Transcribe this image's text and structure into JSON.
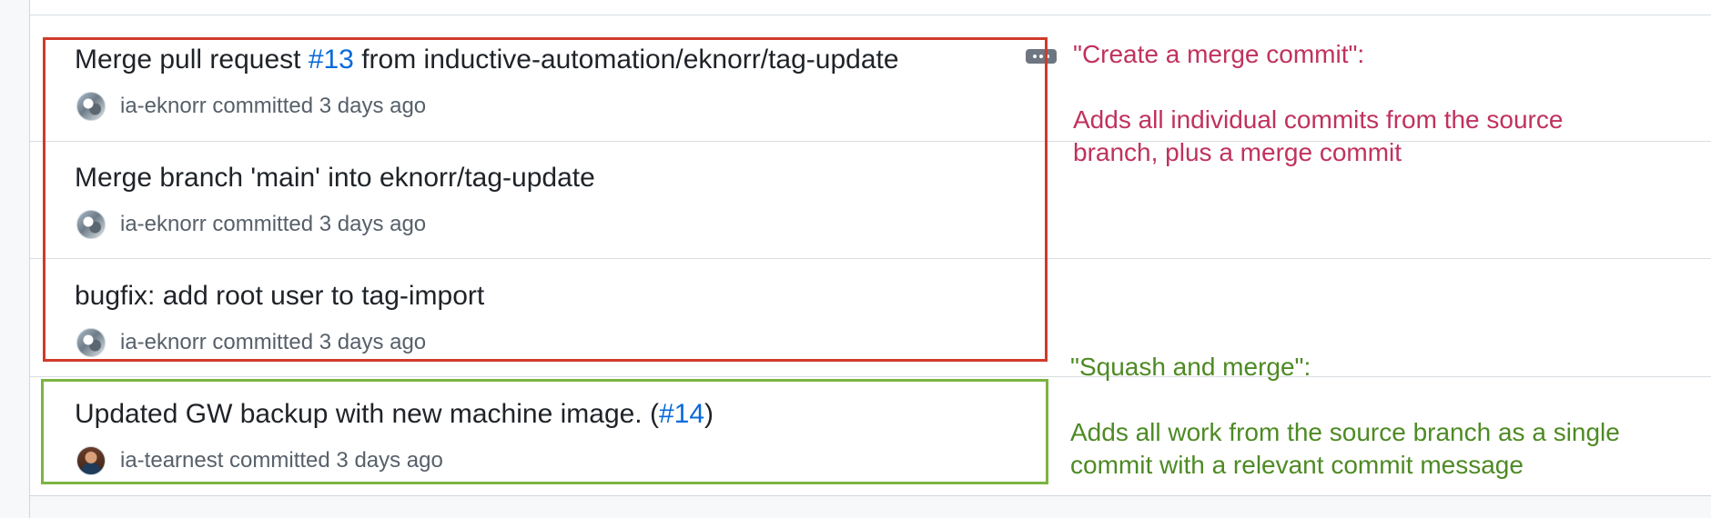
{
  "colors": {
    "link": "#0969da",
    "red_annotation": "#c0325e",
    "green_annotation": "#4e8a24",
    "red_box": "#d03a2b",
    "green_box": "#7cb342"
  },
  "commits": [
    {
      "title_prefix": "Merge pull request ",
      "issue_ref": "#13",
      "title_suffix": " from inductive-automation/eknorr/tag-update",
      "author": "ia-eknorr",
      "meta_text": " committed 3 days ago",
      "avatar_icon": "user-avatar-icon"
    },
    {
      "title": "Merge branch 'main' into eknorr/tag-update",
      "author": "ia-eknorr",
      "meta_text": " committed 3 days ago",
      "avatar_icon": "user-avatar-icon"
    },
    {
      "title": "bugfix: add root user to tag-import",
      "author": "ia-eknorr",
      "meta_text": " committed 3 days ago",
      "avatar_icon": "user-avatar-icon"
    },
    {
      "title_prefix": "Updated GW backup with new machine image. (",
      "issue_ref": "#14",
      "title_suffix": ")",
      "author": "ia-tearnest",
      "meta_text": " committed 3 days ago",
      "avatar_icon": "user-avatar-icon"
    }
  ],
  "annotations": {
    "merge_commit": {
      "heading": "\"Create a merge commit\":",
      "line1": "Adds all individual commits from the source",
      "line2": "branch, plus a merge commit"
    },
    "squash_merge": {
      "heading": "\"Squash and merge\":",
      "line1": "Adds all work from the source branch as a single",
      "line2": "commit with a relevant commit message"
    }
  }
}
